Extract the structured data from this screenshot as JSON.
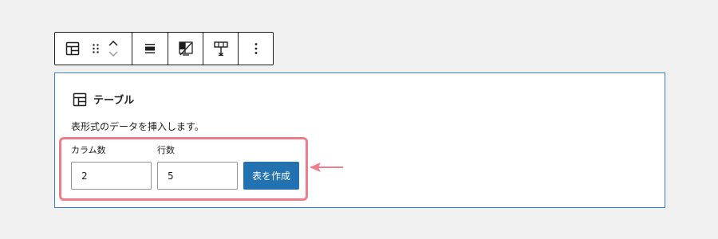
{
  "toolbar": {
    "items": [
      {
        "name": "table-block-icon"
      },
      {
        "name": "drag-handle-icon"
      },
      {
        "name": "move-up-icon"
      },
      {
        "name": "move-down-icon"
      },
      {
        "name": "align-icon"
      },
      {
        "name": "toggle-header-icon"
      },
      {
        "name": "table-column-icon"
      },
      {
        "name": "more-options-icon"
      }
    ]
  },
  "block": {
    "title": "テーブル",
    "description": "表形式のデータを挿入します。",
    "columns_label": "カラム数",
    "columns_value": "2",
    "rows_label": "行数",
    "rows_value": "5",
    "create_button": "表を作成"
  },
  "colors": {
    "accent": "#2271b1",
    "block_border": "#3582c4",
    "annotation": "#ee7d8b",
    "background": "#f0f0f1"
  }
}
